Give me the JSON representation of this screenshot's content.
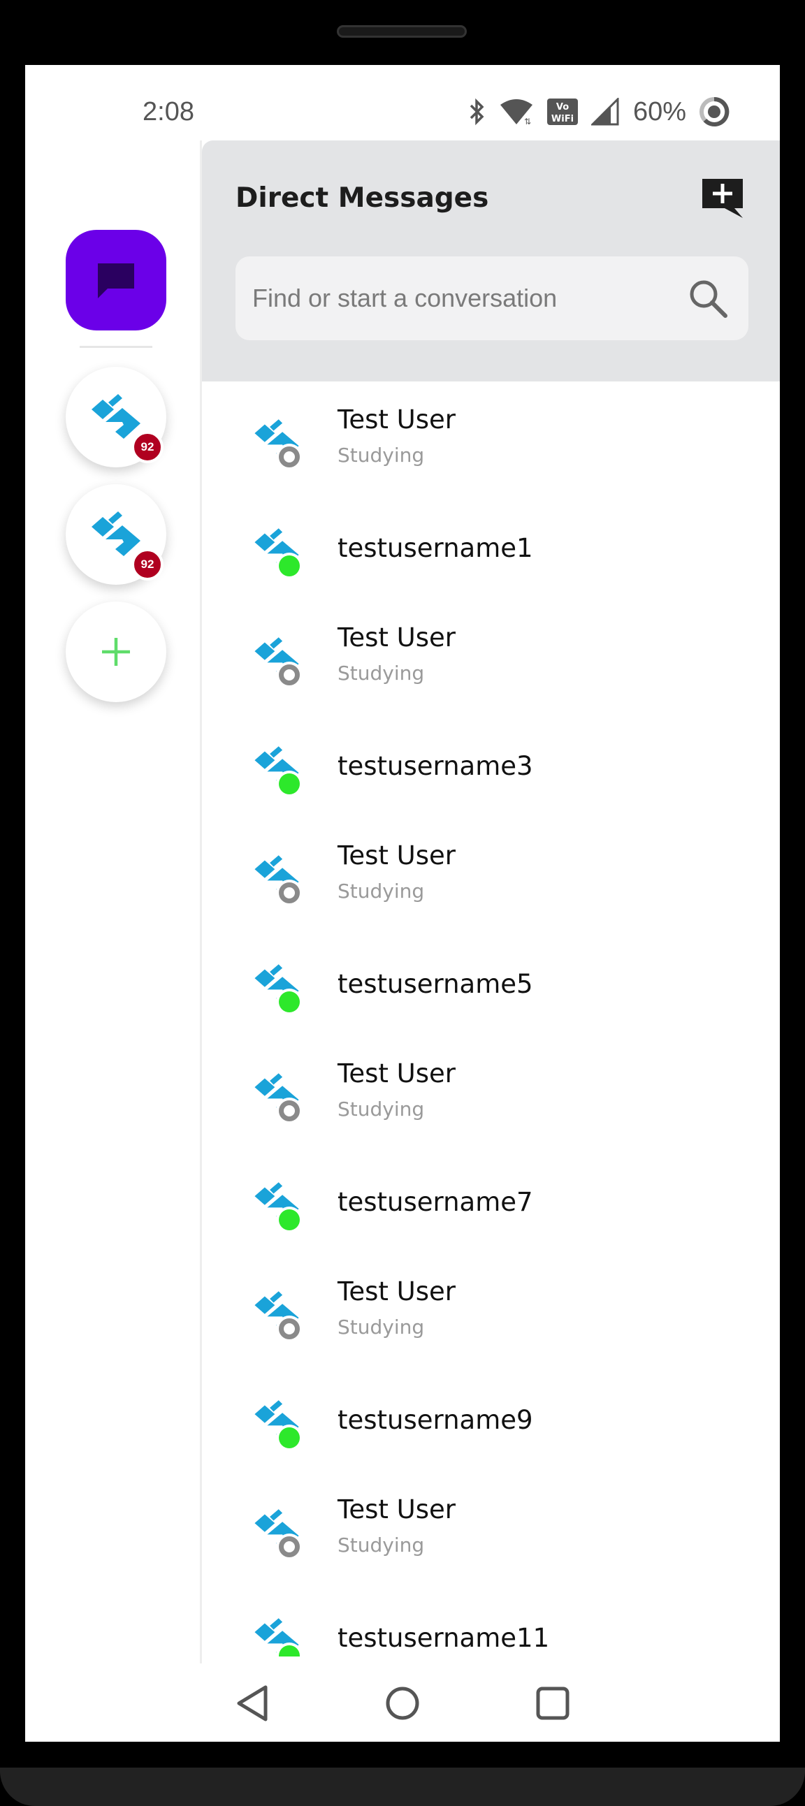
{
  "status_bar": {
    "time": "2:08",
    "battery": "60%",
    "icons": [
      "bluetooth-icon",
      "wifi-icon",
      "vowifi-icon",
      "signal-icon",
      "battery-icon"
    ]
  },
  "rail": {
    "servers": [
      {
        "badge": "92"
      },
      {
        "badge": "92"
      }
    ]
  },
  "panel": {
    "title": "Direct Messages",
    "search_placeholder": "Find or start a conversation"
  },
  "conversations": [
    {
      "name": "Test User",
      "status_text": "Studying",
      "presence": "offline"
    },
    {
      "name": "testusername1",
      "status_text": "",
      "presence": "online"
    },
    {
      "name": "Test User",
      "status_text": "Studying",
      "presence": "offline"
    },
    {
      "name": "testusername3",
      "status_text": "",
      "presence": "online"
    },
    {
      "name": "Test User",
      "status_text": "Studying",
      "presence": "offline"
    },
    {
      "name": "testusername5",
      "status_text": "",
      "presence": "online"
    },
    {
      "name": "Test User",
      "status_text": "Studying",
      "presence": "offline"
    },
    {
      "name": "testusername7",
      "status_text": "",
      "presence": "online"
    },
    {
      "name": "Test User",
      "status_text": "Studying",
      "presence": "offline"
    },
    {
      "name": "testusername9",
      "status_text": "",
      "presence": "online"
    },
    {
      "name": "Test User",
      "status_text": "Studying",
      "presence": "offline"
    },
    {
      "name": "testusername11",
      "status_text": "",
      "presence": "online"
    }
  ],
  "colors": {
    "accent": "#6b00e8",
    "online": "#2de82b",
    "badge": "#b00020",
    "logo": "#1aa3d9"
  }
}
